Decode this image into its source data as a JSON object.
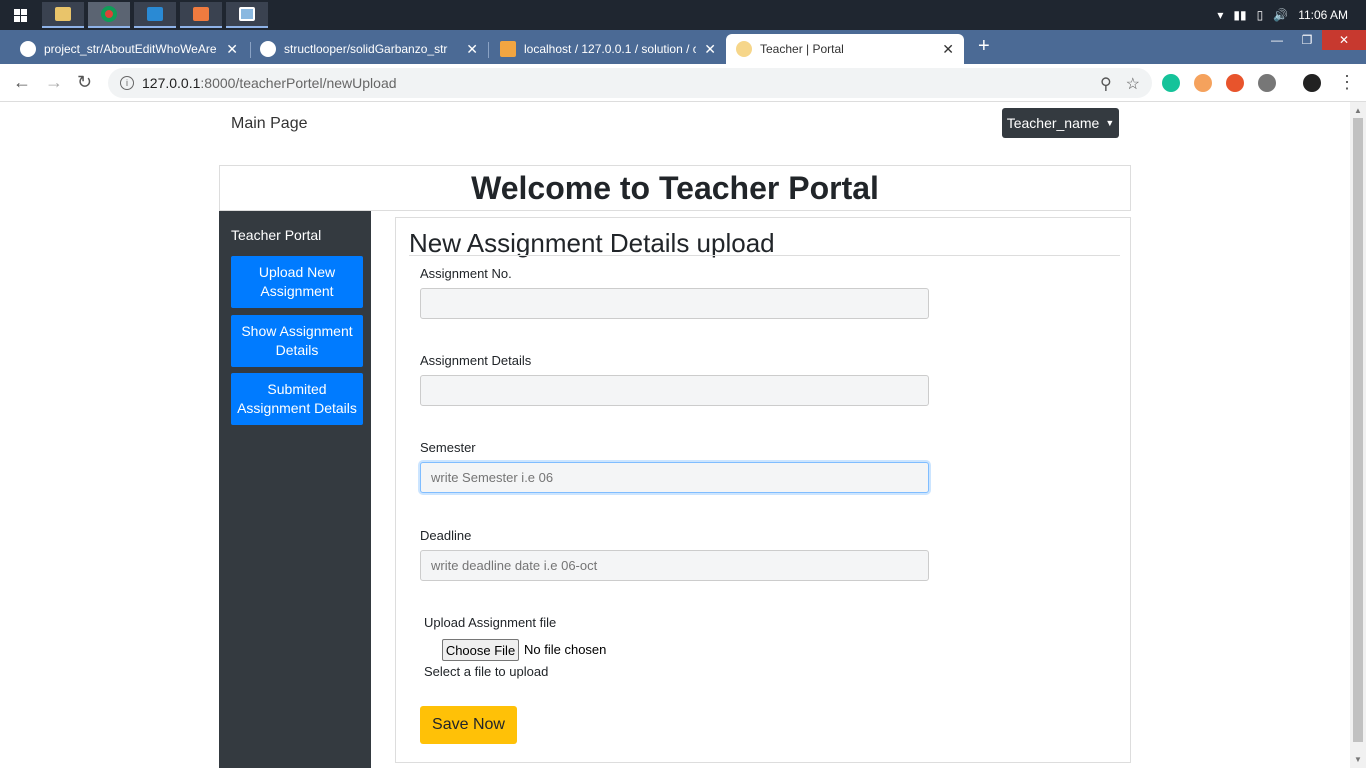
{
  "taskbar": {
    "time": "11:06 AM"
  },
  "tabs": [
    {
      "title": "project_str/AboutEditWhoWeAre"
    },
    {
      "title": "structlooper/solidGarbanzo_str"
    },
    {
      "title": "localhost / 127.0.0.1 / solution / c"
    },
    {
      "title": "Teacher | Portal"
    }
  ],
  "address": {
    "host": "127.0.0.1",
    "path": ":8000/teacherPortel/newUpload"
  },
  "nav": {
    "main_page": "Main Page",
    "teacher_dropdown": "Teacher_name"
  },
  "header": {
    "title": "Welcome to Teacher Portal"
  },
  "sidebar": {
    "title": "Teacher Portal",
    "items": [
      {
        "label": "Upload New Assignment"
      },
      {
        "label": "Show Assignment Details"
      },
      {
        "label": "Submited Assignment Details"
      }
    ]
  },
  "form": {
    "heading": "New Assignment Details upload",
    "assignment_no_label": "Assignment No.",
    "assignment_no_value": "",
    "assignment_details_label": "Assignment Details",
    "assignment_details_value": "",
    "semester_label": "Semester",
    "semester_placeholder": "write Semester i.e 06",
    "deadline_label": "Deadline",
    "deadline_placeholder": "write deadline date i.e 06-oct",
    "upload_label": "Upload Assignment file",
    "choose_file": "Choose File",
    "no_file": "No file chosen",
    "upload_help": "Select a file to upload",
    "save_button": "Save Now"
  },
  "colors": {
    "primary": "#007bff",
    "sidebar_bg": "#343a40",
    "save_button": "#ffc107",
    "tabstrip": "#4b6a95"
  }
}
